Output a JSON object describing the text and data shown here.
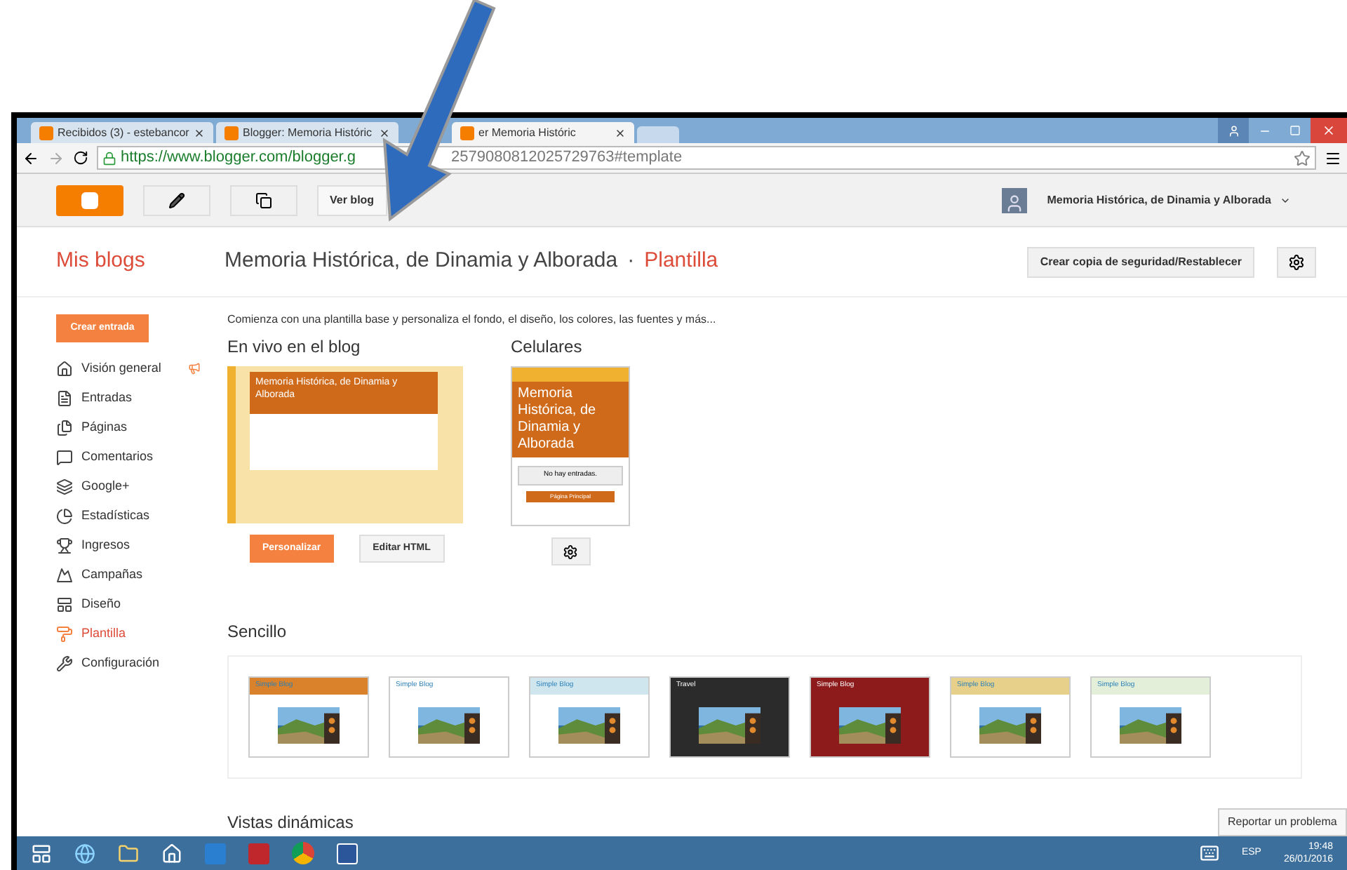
{
  "browser": {
    "tabs": [
      {
        "title": "Recibidos (3) - estebancor",
        "selected": false
      },
      {
        "title": "Blogger: Memoria Históric",
        "selected": false
      },
      {
        "title": "er Memoria Históric",
        "selected": true
      }
    ],
    "url_start": "https://www.blogger.com/blogger.g",
    "url_end": "2579080812025729763#template"
  },
  "topbar": {
    "view_blog": "Ver blog",
    "account": "Memoria Histórica, de Dinamia y Alborada"
  },
  "header": {
    "my_blogs": "Mis blogs",
    "blog_title": "Memoria Histórica, de Dinamia y Alborada",
    "separator": "·",
    "section": "Plantilla",
    "backup_button": "Crear copia de seguridad/Restablecer"
  },
  "sidebar": {
    "new_post": "Crear entrada",
    "items": [
      {
        "label": "Visión general",
        "selected": false
      },
      {
        "label": "Entradas",
        "selected": false
      },
      {
        "label": "Páginas",
        "selected": false
      },
      {
        "label": "Comentarios",
        "selected": false
      },
      {
        "label": "Google+",
        "selected": false
      },
      {
        "label": "Estadísticas",
        "selected": false
      },
      {
        "label": "Ingresos",
        "selected": false
      },
      {
        "label": "Campañas",
        "selected": false
      },
      {
        "label": "Diseño",
        "selected": false
      },
      {
        "label": "Plantilla",
        "selected": true
      },
      {
        "label": "Configuración",
        "selected": false
      }
    ]
  },
  "intro": "Comienza con una plantilla base y personaliza el fondo, el diseño, los colores, las fuentes y más...",
  "live": {
    "heading": "En vivo en el blog",
    "preview_title": "Memoria Histórica, de Dinamia y Alborada",
    "customize": "Personalizar",
    "edit_html": "Editar HTML"
  },
  "mobile": {
    "heading": "Celulares",
    "preview_title": "Memoria Histórica, de Dinamia y Alborada",
    "no_posts": "No hay entradas.",
    "home": "Página Principal"
  },
  "simple": {
    "heading": "Sencillo",
    "templates": [
      {
        "title": "Simple Blog",
        "color": "#d9822b"
      },
      {
        "title": "Simple Blog",
        "color": "#ffffff"
      },
      {
        "title": "Simple Blog",
        "color": "#cfe6ee"
      },
      {
        "title": "Travel",
        "color": "#2b2b2b"
      },
      {
        "title": "Simple Blog",
        "color": "#8e1b1b"
      },
      {
        "title": "Simple Blog",
        "color": "#e6d08a"
      },
      {
        "title": "Simple Blog",
        "color": "#e3efd9"
      }
    ]
  },
  "dynamic": {
    "heading": "Vistas dinámicas"
  },
  "tooltip": "Reportar un problema",
  "taskbar": {
    "language": "ESP",
    "time": "19:48",
    "date": "26/01/2016"
  }
}
